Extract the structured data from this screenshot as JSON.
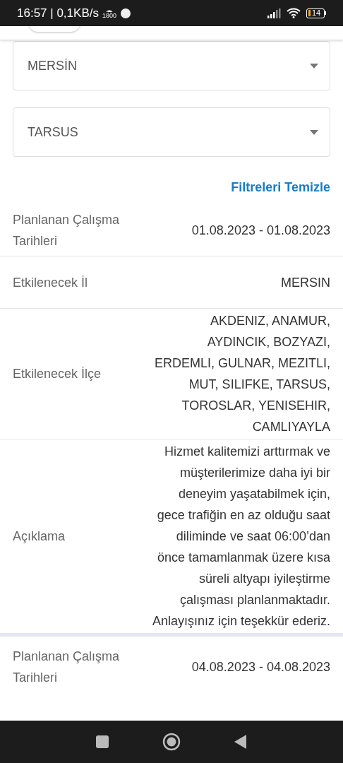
{
  "status_bar": {
    "time": "16:57 | 0,1KB/s",
    "hotspot_label": "1800",
    "battery": "14"
  },
  "filters": [
    {
      "value": "MERSİN"
    },
    {
      "value": "TARSUS"
    }
  ],
  "clear_filters": "Filtreleri Temizle",
  "cards": [
    {
      "rows": [
        {
          "label": "Planlanan Çalışma Tarihleri",
          "value": "01.08.2023 - 01.08.2023"
        },
        {
          "label": "Etkilenecek İl",
          "value": "MERSIN"
        },
        {
          "label": "Etkilenecek İlçe",
          "value": "AKDENIZ, ANAMUR, AYDINCIK, BOZYAZI, ERDEMLI, GULNAR, MEZITLI, MUT, SILIFKE, TARSUS, TOROSLAR, YENISEHIR, CAMLIYAYLA"
        },
        {
          "label": "Açıklama",
          "value": "Hizmet kalitemizi arttırmak ve müşterilerimize daha iyi bir deneyim yaşatabilmek için, gece trafiğin en az olduğu saat diliminde ve saat 06:00’dan önce tamamlanmak üzere kısa süreli altyapı iyileştirme çalışması planlanmaktadır. Anlayışınız için teşekkür ederiz."
        }
      ]
    },
    {
      "rows": [
        {
          "label": "Planlanan Çalışma Tarihleri",
          "value": "04.08.2023 - 04.08.2023"
        }
      ]
    }
  ]
}
